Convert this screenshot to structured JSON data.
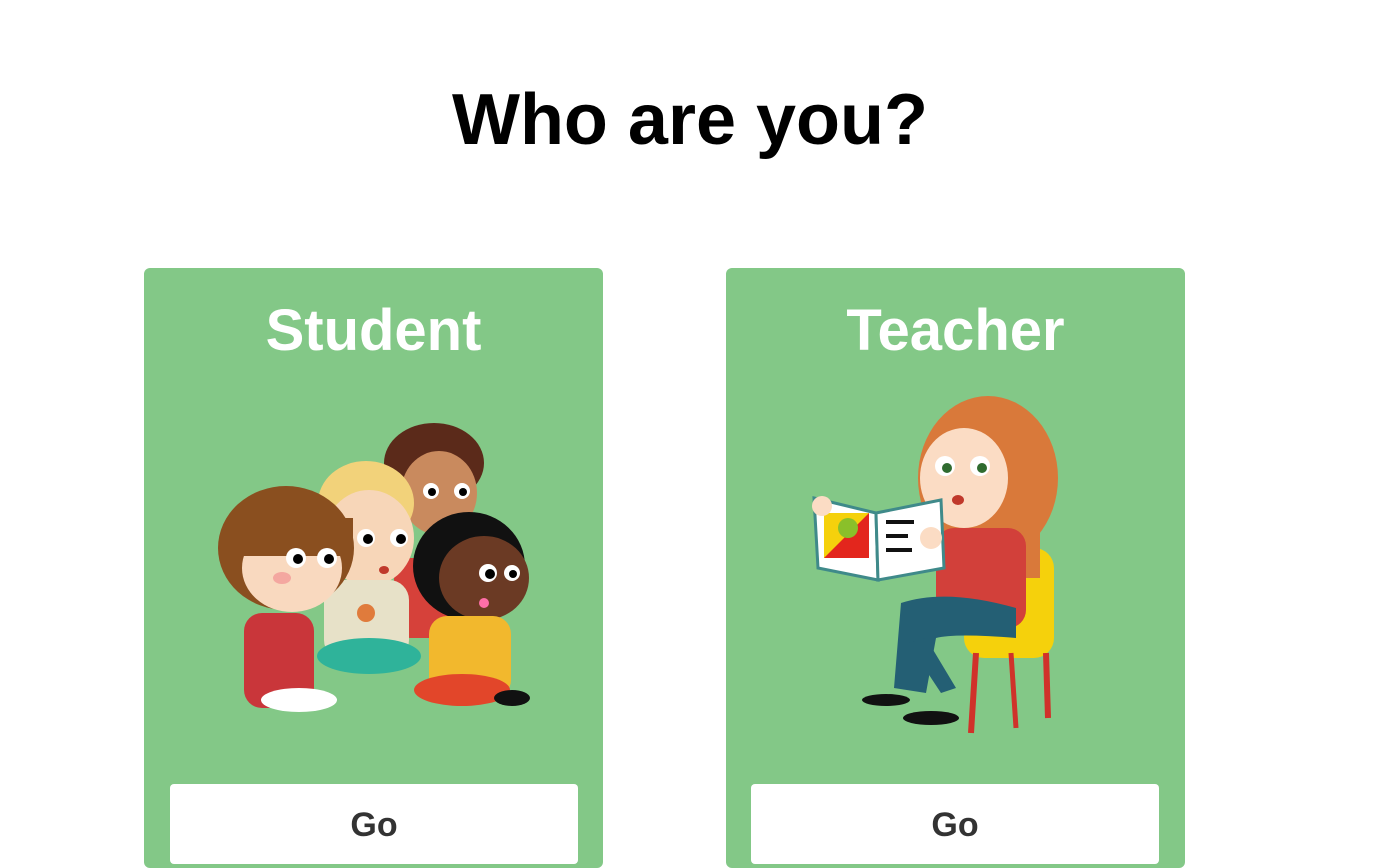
{
  "page": {
    "title": "Who are you?"
  },
  "cards": [
    {
      "id": "student",
      "title": "Student",
      "illustration": "children-sitting-illustration",
      "button_label": "Go"
    },
    {
      "id": "teacher",
      "title": "Teacher",
      "illustration": "teacher-reading-book-illustration",
      "button_label": "Go"
    }
  ],
  "colors": {
    "card_background": "#83c887",
    "card_title": "#ffffff",
    "button_background": "#ffffff",
    "button_text": "#333333",
    "page_title": "#000000"
  }
}
